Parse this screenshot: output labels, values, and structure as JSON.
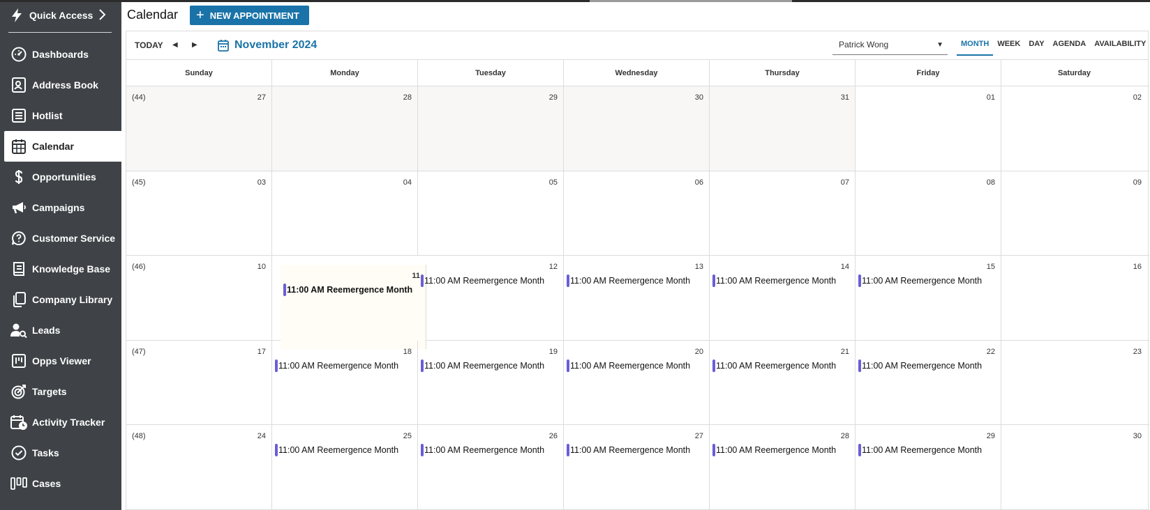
{
  "sidebar": {
    "quick_access": "Quick Access",
    "items": [
      {
        "label": "Dashboards",
        "icon": "dashboard-icon"
      },
      {
        "label": "Address Book",
        "icon": "contact-card-icon"
      },
      {
        "label": "Hotlist",
        "icon": "list-icon"
      },
      {
        "label": "Calendar",
        "icon": "calendar-icon",
        "active": true
      },
      {
        "label": "Opportunities",
        "icon": "dollar-icon"
      },
      {
        "label": "Campaigns",
        "icon": "megaphone-icon"
      },
      {
        "label": "Customer Service",
        "icon": "question-bubble-icon"
      },
      {
        "label": "Knowledge Base",
        "icon": "book-icon"
      },
      {
        "label": "Company Library",
        "icon": "copy-icon"
      },
      {
        "label": "Leads",
        "icon": "user-search-icon"
      },
      {
        "label": "Opps Viewer",
        "icon": "kanban-icon"
      },
      {
        "label": "Targets",
        "icon": "target-icon"
      },
      {
        "label": "Activity Tracker",
        "icon": "calendar-clock-icon"
      },
      {
        "label": "Tasks",
        "icon": "check-circle-icon"
      },
      {
        "label": "Cases",
        "icon": "columns-icon"
      }
    ]
  },
  "header": {
    "title": "Calendar",
    "new_button": "NEW APPOINTMENT"
  },
  "toolbar": {
    "today": "TODAY",
    "month_label": "November 2024",
    "user": "Patrick Wong",
    "views": [
      "MONTH",
      "WEEK",
      "DAY",
      "AGENDA",
      "AVAILABILITY"
    ],
    "active_view": "MONTH"
  },
  "calendar": {
    "weekdays": [
      "Sunday",
      "Monday",
      "Tuesday",
      "Wednesday",
      "Thursday",
      "Friday",
      "Saturday"
    ],
    "weeks": [
      {
        "week": "(44)",
        "days": [
          "27",
          "28",
          "29",
          "30",
          "31",
          "01",
          "02"
        ]
      },
      {
        "week": "(45)",
        "days": [
          "03",
          "04",
          "05",
          "06",
          "07",
          "08",
          "09"
        ]
      },
      {
        "week": "(46)",
        "days": [
          "10",
          "11",
          "12",
          "13",
          "14",
          "15",
          "16"
        ]
      },
      {
        "week": "(47)",
        "days": [
          "17",
          "18",
          "19",
          "20",
          "21",
          "22",
          "23"
        ]
      },
      {
        "week": "(48)",
        "days": [
          "24",
          "25",
          "26",
          "27",
          "28",
          "29",
          "30"
        ]
      }
    ],
    "event_text": "11:00 AM Reemergence Month",
    "event_color": "#6a5ed8",
    "accent_color": "#1a73a8"
  }
}
